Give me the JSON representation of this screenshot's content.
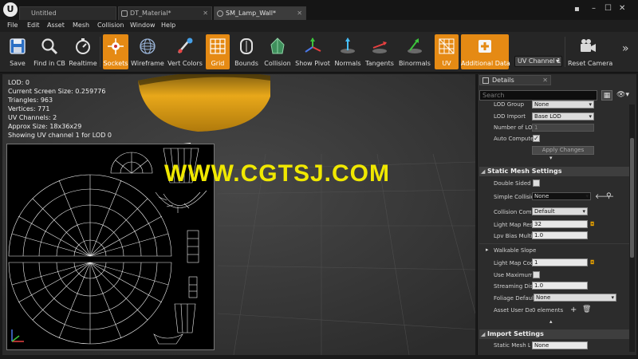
{
  "window": {
    "tabs": [
      {
        "label": "Untitled"
      },
      {
        "label": "DT_Material*"
      },
      {
        "label": "SM_Lamp_Wall*"
      }
    ]
  },
  "menu": [
    "File",
    "Edit",
    "Asset",
    "Mesh",
    "Collision",
    "Window",
    "Help"
  ],
  "toolbar": {
    "buttons": [
      {
        "label": "Save",
        "icon": "save-icon",
        "active": false
      },
      {
        "label": "Find in CB",
        "icon": "find-in-content-browser-icon",
        "active": false
      },
      {
        "label": "Realtime",
        "icon": "realtime-icon",
        "active": false
      },
      {
        "label": "Sockets",
        "icon": "sockets-icon",
        "active": true
      },
      {
        "label": "Wireframe",
        "icon": "wireframe-icon",
        "active": false
      },
      {
        "label": "Vert Colors",
        "icon": "vert-colors-icon",
        "active": false
      },
      {
        "label": "Grid",
        "icon": "grid-icon",
        "active": true
      },
      {
        "label": "Bounds",
        "icon": "bounds-icon",
        "active": false
      },
      {
        "label": "Collision",
        "icon": "collision-icon",
        "active": false
      },
      {
        "label": "Show Pivot",
        "icon": "show-pivot-icon",
        "active": false
      },
      {
        "label": "Normals",
        "icon": "normals-icon",
        "active": false
      },
      {
        "label": "Tangents",
        "icon": "tangents-icon",
        "active": false
      },
      {
        "label": "Binormals",
        "icon": "binormals-icon",
        "active": false
      },
      {
        "label": "UV",
        "icon": "uv-icon",
        "active": true
      },
      {
        "label": "Additional Data",
        "icon": "additional-data-icon",
        "active": true
      },
      {
        "label": "Reset Camera",
        "icon": "reset-camera-icon",
        "active": false
      }
    ],
    "uv_channel": "UV Channel 1",
    "accent": "#e58a14"
  },
  "viewport": {
    "stats": [
      "LOD:  0",
      "Current Screen Size:  0.259776",
      "Triangles:  963",
      "Vertices:  771",
      "UV Channels:  2",
      "Approx Size: 18x36x29",
      "Showing UV channel 1 for LOD 0"
    ],
    "watermark": "WWW.CGTSJ.COM",
    "watermark_color": "#f0e800"
  },
  "details": {
    "tab_label": "Details",
    "search_placeholder": "Search",
    "lod_rows": {
      "lod_group": {
        "label": "LOD Group",
        "value": "None"
      },
      "lod_import": {
        "label": "LOD Import",
        "value": "Base LOD"
      },
      "number_of_lods": {
        "label": "Number of LOD",
        "value": "1"
      },
      "auto_compute": {
        "label": "Auto Compute",
        "checked": true
      },
      "apply_changes": "Apply Changes"
    },
    "static_mesh_settings": {
      "title": "Static Mesh Settings",
      "double_sided": {
        "label": "Double Sided G",
        "checked": false
      },
      "simple_collision": {
        "label": "Simple Collisio",
        "value": "None"
      },
      "collision_complexity": {
        "label": "Collision Comp",
        "value": "Default"
      },
      "light_map_res": {
        "label": "Light Map Res",
        "value": "32"
      },
      "lpv_bias": {
        "label": "Lpv Bias Multi",
        "value": "1.0"
      },
      "walkable_slope": {
        "label": "Walkable Slope"
      },
      "light_map_coord": {
        "label": "Light Map Coo",
        "value": "1"
      },
      "use_maximum": {
        "label": "Use Maximum",
        "checked": false
      },
      "streaming_dist": {
        "label": "Streaming Dist",
        "value": "1.0"
      },
      "foliage_default": {
        "label": "Foliage Default",
        "value": "None"
      },
      "asset_user_data": {
        "label": "Asset User Dat",
        "value": "0 elements"
      }
    },
    "import_settings": {
      "title": "Import Settings",
      "static_mesh_lod": {
        "label": "Static Mesh LO",
        "value": "None"
      }
    }
  }
}
